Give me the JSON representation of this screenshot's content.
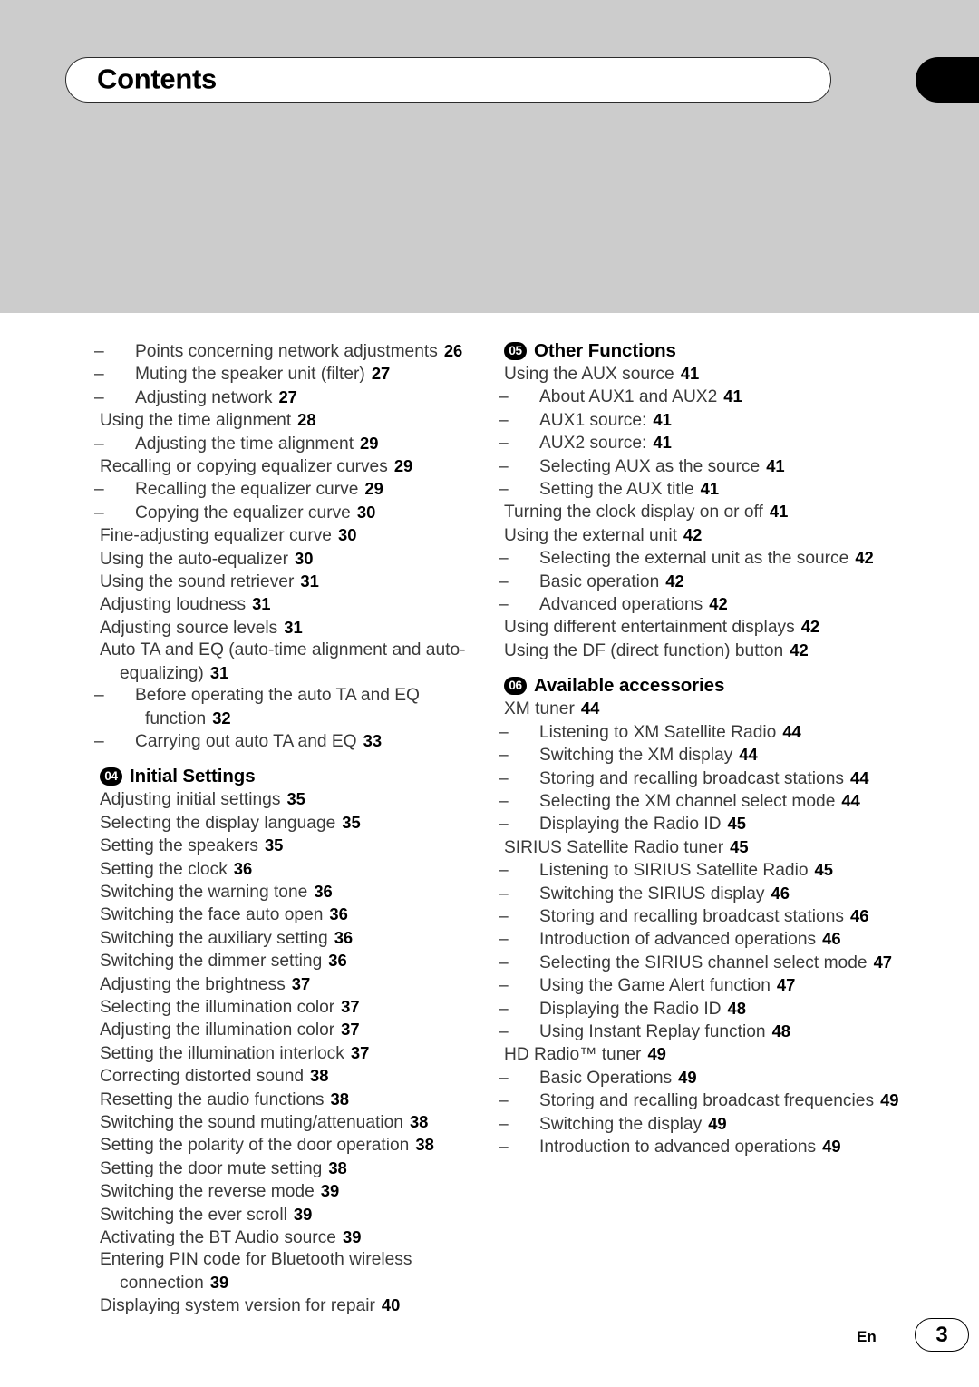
{
  "header": {
    "title": "Contents",
    "tab_icon": "black-tab-marker"
  },
  "footer": {
    "language": "En",
    "page_number": "3"
  },
  "left_column": [
    {
      "type": "sub",
      "label": "Points concerning network adjustments",
      "page": "26"
    },
    {
      "type": "sub",
      "label": "Muting the speaker unit (filter)",
      "page": "27"
    },
    {
      "type": "sub",
      "label": "Adjusting network",
      "page": "27"
    },
    {
      "type": "main",
      "label": "Using the time alignment",
      "page": "28"
    },
    {
      "type": "sub",
      "label": "Adjusting the time alignment",
      "page": "29"
    },
    {
      "type": "main",
      "label": "Recalling or copying equalizer curves",
      "page": "29"
    },
    {
      "type": "sub",
      "label": "Recalling the equalizer curve",
      "page": "29"
    },
    {
      "type": "sub",
      "label": "Copying the equalizer curve",
      "page": "30"
    },
    {
      "type": "main",
      "label": "Fine-adjusting equalizer curve",
      "page": "30"
    },
    {
      "type": "main",
      "label": "Using the auto-equalizer",
      "page": "30"
    },
    {
      "type": "main",
      "label": "Using the sound retriever",
      "page": "31"
    },
    {
      "type": "main",
      "label": "Adjusting loudness",
      "page": "31"
    },
    {
      "type": "main",
      "label": "Adjusting source levels",
      "page": "31"
    },
    {
      "type": "main",
      "label": "Auto TA and EQ (auto-time alignment and auto-equalizing)",
      "page": "31"
    },
    {
      "type": "sub",
      "label": "Before operating the auto TA and EQ function",
      "page": "32"
    },
    {
      "type": "sub",
      "label": "Carrying out auto TA and EQ",
      "page": "33"
    },
    {
      "type": "section",
      "badge": "04",
      "label": "Initial Settings"
    },
    {
      "type": "main",
      "label": "Adjusting initial settings",
      "page": "35"
    },
    {
      "type": "main",
      "label": "Selecting the display language",
      "page": "35"
    },
    {
      "type": "main",
      "label": "Setting the speakers",
      "page": "35"
    },
    {
      "type": "main",
      "label": "Setting the clock",
      "page": "36"
    },
    {
      "type": "main",
      "label": "Switching the warning tone",
      "page": "36"
    },
    {
      "type": "main",
      "label": "Switching the face auto open",
      "page": "36"
    },
    {
      "type": "main",
      "label": "Switching the auxiliary setting",
      "page": "36"
    },
    {
      "type": "main",
      "label": "Switching the dimmer setting",
      "page": "36"
    },
    {
      "type": "main",
      "label": "Adjusting the brightness",
      "page": "37"
    },
    {
      "type": "main",
      "label": "Selecting the illumination color",
      "page": "37"
    },
    {
      "type": "main",
      "label": "Adjusting the illumination color",
      "page": "37"
    },
    {
      "type": "main",
      "label": "Setting the illumination interlock",
      "page": "37"
    },
    {
      "type": "main",
      "label": "Correcting distorted sound",
      "page": "38"
    },
    {
      "type": "main",
      "label": "Resetting the audio functions",
      "page": "38"
    },
    {
      "type": "main",
      "label": "Switching the sound muting/attenuation",
      "page": "38"
    },
    {
      "type": "main",
      "label": "Setting the polarity of the door operation",
      "page": "38"
    },
    {
      "type": "main",
      "label": "Setting the door mute setting",
      "page": "38"
    },
    {
      "type": "main",
      "label": "Switching the reverse mode",
      "page": "39"
    },
    {
      "type": "main",
      "label": "Switching the ever scroll",
      "page": "39"
    },
    {
      "type": "main",
      "label": "Activating the BT Audio source",
      "page": "39"
    },
    {
      "type": "main",
      "label": "Entering PIN code for Bluetooth wireless connection",
      "page": "39"
    },
    {
      "type": "main",
      "label": "Displaying system version for repair",
      "page": "40"
    }
  ],
  "right_column": [
    {
      "type": "section",
      "badge": "05",
      "label": "Other Functions",
      "first": true
    },
    {
      "type": "main",
      "label": "Using the AUX source",
      "page": "41"
    },
    {
      "type": "sub",
      "label": "About AUX1 and AUX2",
      "page": "41"
    },
    {
      "type": "sub",
      "label": "AUX1 source:",
      "page": "41"
    },
    {
      "type": "sub",
      "label": "AUX2 source:",
      "page": "41"
    },
    {
      "type": "sub",
      "label": "Selecting AUX as the source",
      "page": "41"
    },
    {
      "type": "sub",
      "label": "Setting the AUX title",
      "page": "41"
    },
    {
      "type": "main",
      "label": "Turning the clock display on or off",
      "page": "41"
    },
    {
      "type": "main",
      "label": "Using the external unit",
      "page": "42"
    },
    {
      "type": "sub",
      "label": "Selecting the external unit as the source",
      "page": "42"
    },
    {
      "type": "sub",
      "label": "Basic operation",
      "page": "42"
    },
    {
      "type": "sub",
      "label": "Advanced operations",
      "page": "42"
    },
    {
      "type": "main",
      "label": "Using different entertainment displays",
      "page": "42"
    },
    {
      "type": "main",
      "label": "Using the DF (direct function) button",
      "page": "42"
    },
    {
      "type": "section",
      "badge": "06",
      "label": "Available accessories"
    },
    {
      "type": "main",
      "label": "XM tuner",
      "page": "44"
    },
    {
      "type": "sub",
      "label": "Listening to XM Satellite Radio",
      "page": "44"
    },
    {
      "type": "sub",
      "label": "Switching the XM display",
      "page": "44"
    },
    {
      "type": "sub",
      "label": "Storing and recalling broadcast stations",
      "page": "44"
    },
    {
      "type": "sub",
      "label": "Selecting the XM channel select mode",
      "page": "44"
    },
    {
      "type": "sub",
      "label": "Displaying the Radio ID",
      "page": "45"
    },
    {
      "type": "main",
      "label": "SIRIUS Satellite Radio tuner",
      "page": "45"
    },
    {
      "type": "sub",
      "label": "Listening to SIRIUS Satellite Radio",
      "page": "45"
    },
    {
      "type": "sub",
      "label": "Switching the SIRIUS display",
      "page": "46"
    },
    {
      "type": "sub",
      "label": "Storing and recalling broadcast stations",
      "page": "46"
    },
    {
      "type": "sub",
      "label": "Introduction of advanced operations",
      "page": "46"
    },
    {
      "type": "sub",
      "label": "Selecting the SIRIUS channel select mode",
      "page": "47"
    },
    {
      "type": "sub",
      "label": "Using the Game Alert function",
      "page": "47"
    },
    {
      "type": "sub",
      "label": "Displaying the Radio ID",
      "page": "48"
    },
    {
      "type": "sub",
      "label": "Using Instant Replay function",
      "page": "48"
    },
    {
      "type": "main",
      "label": "HD Radio™ tuner",
      "page": "49"
    },
    {
      "type": "sub",
      "label": "Basic Operations",
      "page": "49"
    },
    {
      "type": "sub",
      "label": "Storing and recalling broadcast frequencies",
      "page": "49"
    },
    {
      "type": "sub",
      "label": "Switching the display",
      "page": "49"
    },
    {
      "type": "sub",
      "label": "Introduction to advanced operations",
      "page": "49"
    }
  ]
}
